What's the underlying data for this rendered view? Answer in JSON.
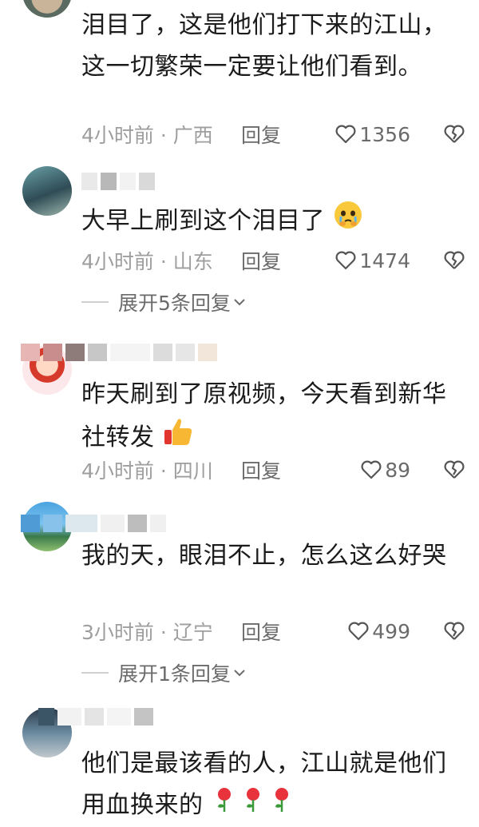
{
  "comments": [
    {
      "text": "泪目了，这是他们打下来的江山，这一切繁荣一定要让他们看到。",
      "time_location": "4小时前 · 广西",
      "reply_label": "回复",
      "likes": "1356"
    },
    {
      "text": "大早上刷到这个泪目了",
      "emoji": "crying-face",
      "time_location": "4小时前 · 山东",
      "reply_label": "回复",
      "likes": "1474",
      "expand_label": "展开5条回复"
    },
    {
      "text": "昨天刷到了原视频，今天看到新华社转发",
      "emoji": "thumbs-up",
      "time_location": "4小时前 · 四川",
      "reply_label": "回复",
      "likes": "89"
    },
    {
      "text": "我的天，眼泪不止，怎么这么好哭",
      "time_location": "3小时前 · 辽宁",
      "reply_label": "回复",
      "likes": "499",
      "expand_label": "展开1条回复"
    },
    {
      "text": "他们是最该看的人，江山就是他们用血换来的",
      "emoji": "rose ×3"
    }
  ],
  "colors": {
    "text": "#1b1b1b",
    "meta": "#9e9e9e",
    "action": "#6b6b6b",
    "background": "#ffffff"
  }
}
